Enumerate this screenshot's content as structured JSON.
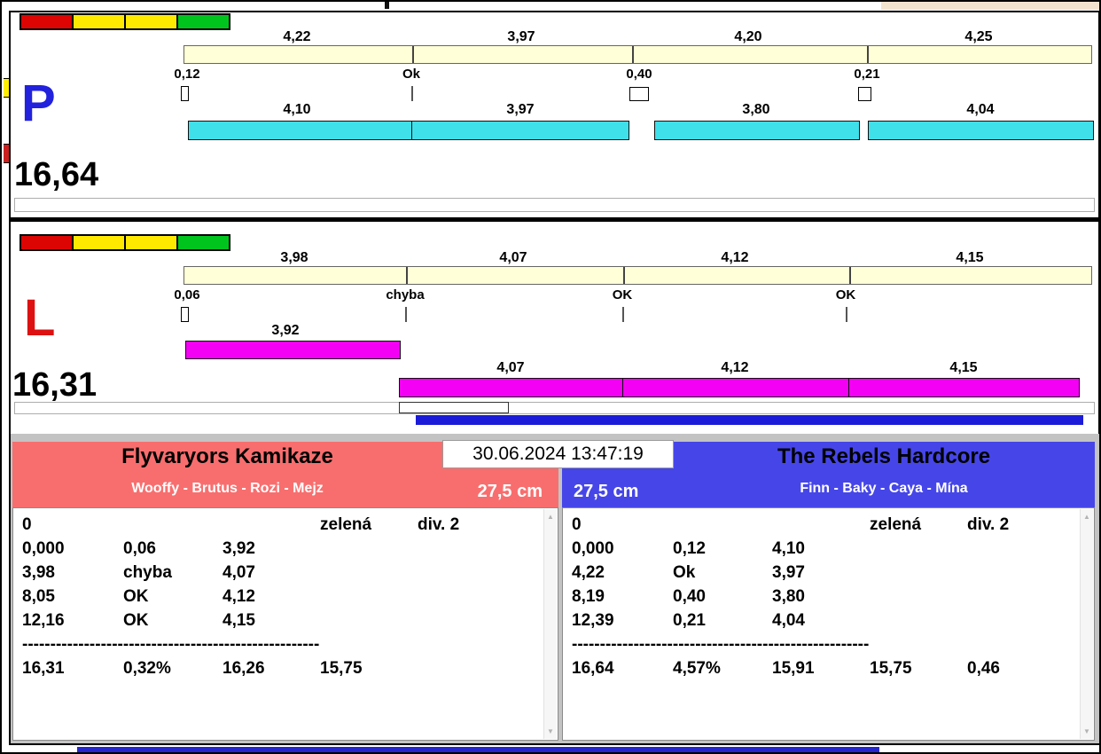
{
  "colors": {
    "light_red": "#dd0404",
    "light_yellow": "#ffe900",
    "light_green": "#00c41e",
    "lane_p_run_bar": "#3fe0ea",
    "lane_l_run_bar": "#f400f4",
    "reference_bar": "#ffffd8",
    "progress_bar_blue": "#1b1bd8",
    "left_team_header": "#f86e6e",
    "right_team_header": "#4646e8",
    "letter_p": "#2222dd",
    "letter_l": "#dd1111"
  },
  "lane_p": {
    "letter": "P",
    "total": "16,64",
    "reference_splits": [
      "4,22",
      "3,97",
      "4,20",
      "4,25"
    ],
    "change_markers": [
      "0,12",
      "Ok",
      "0,40",
      "0,21"
    ],
    "run_splits": [
      "4,10",
      "3,97",
      "3,80",
      "4,04"
    ]
  },
  "lane_l": {
    "letter": "L",
    "total": "16,31",
    "reference_splits": [
      "3,98",
      "4,07",
      "4,12",
      "4,15"
    ],
    "change_markers": [
      "0,06",
      "chyba",
      "OK",
      "OK"
    ],
    "first_run_split": "3,92",
    "run_splits": [
      "4,07",
      "4,12",
      "4,15"
    ]
  },
  "scoreboard": {
    "datetime": "30.06.2024 13:47:19",
    "left": {
      "team": "Flyvaryors Kamikaze",
      "dogs": "Wooffy - Brutus - Rozi - Mejz",
      "jump_height": "27,5 cm",
      "rows": [
        [
          "0",
          "",
          "",
          "zelená",
          "div. 2"
        ],
        [
          "0,000",
          "0,06",
          "3,92",
          "",
          ""
        ],
        [
          "3,98",
          "chyba",
          "4,07",
          "",
          ""
        ],
        [
          "8,05",
          "OK",
          "4,12",
          "",
          ""
        ],
        [
          "12,16",
          "OK",
          "4,15",
          "",
          ""
        ]
      ],
      "separator": "-----------------------------------------------------",
      "summary": [
        "16,31",
        "0,32%",
        "16,26",
        "15,75",
        ""
      ]
    },
    "right": {
      "team": "The Rebels Hardcore",
      "dogs": "Finn - Baky - Caya - Mína",
      "jump_height": "27,5 cm",
      "rows": [
        [
          "0",
          "",
          "",
          "zelená",
          "div. 2"
        ],
        [
          "0,000",
          "0,12",
          "4,10",
          "",
          ""
        ],
        [
          "4,22",
          "Ok",
          "3,97",
          "",
          ""
        ],
        [
          "8,19",
          "0,40",
          "3,80",
          "",
          ""
        ],
        [
          "12,39",
          "0,21",
          "4,04",
          "",
          ""
        ]
      ],
      "separator": "-----------------------------------------------------",
      "summary": [
        "16,64",
        "4,57%",
        "15,91",
        "15,75",
        "0,46"
      ]
    }
  }
}
